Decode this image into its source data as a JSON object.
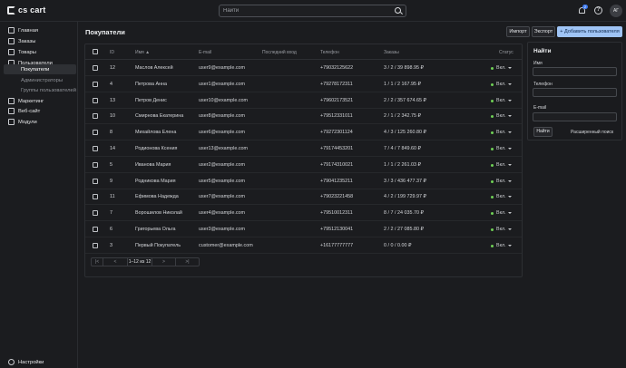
{
  "brand": {
    "name": "cs cart"
  },
  "search": {
    "placeholder": "Найти"
  },
  "notifications": {
    "count": "2"
  },
  "user": {
    "initials": "АГ"
  },
  "sidebar": {
    "items": [
      {
        "label": "Главная",
        "icon": "home-icon"
      },
      {
        "label": "Заказы",
        "icon": "orders-icon"
      },
      {
        "label": "Товары",
        "icon": "products-icon"
      },
      {
        "label": "Пользователи",
        "icon": "users-icon"
      },
      {
        "label": "Покупатели",
        "sub": true,
        "active": true
      },
      {
        "label": "Администраторы",
        "sub": true
      },
      {
        "label": "Группы пользователей",
        "sub": true
      },
      {
        "label": "Маркетинг",
        "icon": "marketing-icon"
      },
      {
        "label": "Веб-сайт",
        "icon": "website-icon"
      },
      {
        "label": "Модули",
        "icon": "modules-icon"
      }
    ],
    "settings_label": "Настройки"
  },
  "page": {
    "title": "Покупатели",
    "import_label": "Импорт",
    "export_label": "Экспорт",
    "add_label": "+ Добавить пользователя"
  },
  "table": {
    "headers": {
      "id": "ID",
      "name": "Имя",
      "email": "E-mail",
      "last_login": "Последний вход",
      "phone": "Телефон",
      "orders": "Заказы",
      "status": "Статус"
    },
    "rows": [
      {
        "id": "12",
        "name": "Маслов Алексей",
        "email": "user9@example.com",
        "last_login": "",
        "phone": "+79032125622",
        "orders": "3 / 2 / 39 898.95 ₽",
        "status": "Вкл."
      },
      {
        "id": "4",
        "name": "Петрова Анна",
        "email": "user1@example.com",
        "last_login": "",
        "phone": "+79278172311",
        "orders": "1 / 1 / 2 167.95 ₽",
        "status": "Вкл."
      },
      {
        "id": "13",
        "name": "Петров Денис",
        "email": "user10@example.com",
        "last_login": "",
        "phone": "+79602173521",
        "orders": "2 / 2 / 357 674.65 ₽",
        "status": "Вкл."
      },
      {
        "id": "10",
        "name": "Смирнова Екатерина",
        "email": "user8@example.com",
        "last_login": "",
        "phone": "+79512331011",
        "orders": "2 / 1 / 2 342.75 ₽",
        "status": "Вкл."
      },
      {
        "id": "8",
        "name": "Михайлова Елена",
        "email": "user6@example.com",
        "last_login": "",
        "phone": "+79272301124",
        "orders": "4 / 3 / 125 260.80 ₽",
        "status": "Вкл."
      },
      {
        "id": "14",
        "name": "Родионова Ксения",
        "email": "user13@example.com",
        "last_login": "",
        "phone": "+79174453201",
        "orders": "7 / 4 / 7 849.60 ₽",
        "status": "Вкл."
      },
      {
        "id": "5",
        "name": "Иванова Мария",
        "email": "user2@example.com",
        "last_login": "",
        "phone": "+79174310021",
        "orders": "1 / 1 / 2 261.03 ₽",
        "status": "Вкл."
      },
      {
        "id": "9",
        "name": "Родникова Мария",
        "email": "user5@example.com",
        "last_login": "",
        "phone": "+79041235211",
        "orders": "3 / 3 / 436 477.37 ₽",
        "status": "Вкл."
      },
      {
        "id": "11",
        "name": "Ефимова Надежда",
        "email": "user7@example.com",
        "last_login": "",
        "phone": "+79023221458",
        "orders": "4 / 2 / 199 729.97 ₽",
        "status": "Вкл."
      },
      {
        "id": "7",
        "name": "Ворошилов Николай",
        "email": "user4@example.com",
        "last_login": "",
        "phone": "+79510012311",
        "orders": "8 / 7 / 24 035.70 ₽",
        "status": "Вкл."
      },
      {
        "id": "6",
        "name": "Григорьева Ольга",
        "email": "user3@example.com",
        "last_login": "",
        "phone": "+79512130041",
        "orders": "2 / 2 / 27 085.80 ₽",
        "status": "Вкл."
      },
      {
        "id": "3",
        "name": "Первый Покупатель",
        "email": "customer@example.com",
        "last_login": "",
        "phone": "+16177777777",
        "orders": "0 / 0 / 0.00 ₽",
        "status": "Вкл."
      }
    ]
  },
  "pagination": {
    "first": "|<",
    "prev": "<",
    "range": "1–12 из 12",
    "next": ">",
    "last": ">|"
  },
  "filter": {
    "title": "Найти",
    "name_label": "Имя",
    "phone_label": "Телефон",
    "email_label": "E-mail",
    "submit_label": "Найти",
    "advanced_label": "Расширенный поиск"
  },
  "colors": {
    "accent": "#9fc4f5",
    "status_on": "#6fcf55",
    "background": "#1b1c1f"
  }
}
